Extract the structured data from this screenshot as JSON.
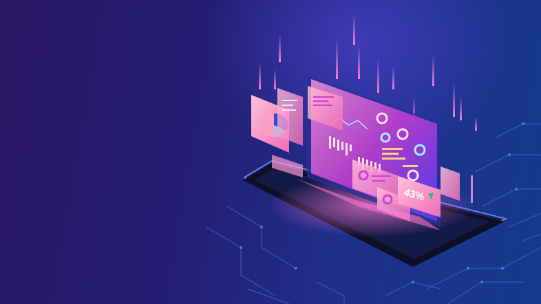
{
  "illustration": {
    "subject": "isometric-smartphone-with-holographic-analytics-dashboard",
    "colors": {
      "bg_left": "#2a1863",
      "bg_right": "#153a8c",
      "panel_pink": "#f06bb8",
      "panel_magenta": "#d23fd6",
      "panel_light": "#ffc1d8",
      "glow": "#ff7ad9",
      "circuit": "#3d66c9",
      "phone_body": "#0c0f25",
      "phone_edge": "#6c7fe0"
    },
    "panel_readout": {
      "percent": "43%"
    },
    "icons": [
      "pie-chart-icon",
      "bar-chart-icon",
      "donut-chart-icon",
      "line-chart-icon",
      "arrow-up-icon"
    ]
  }
}
